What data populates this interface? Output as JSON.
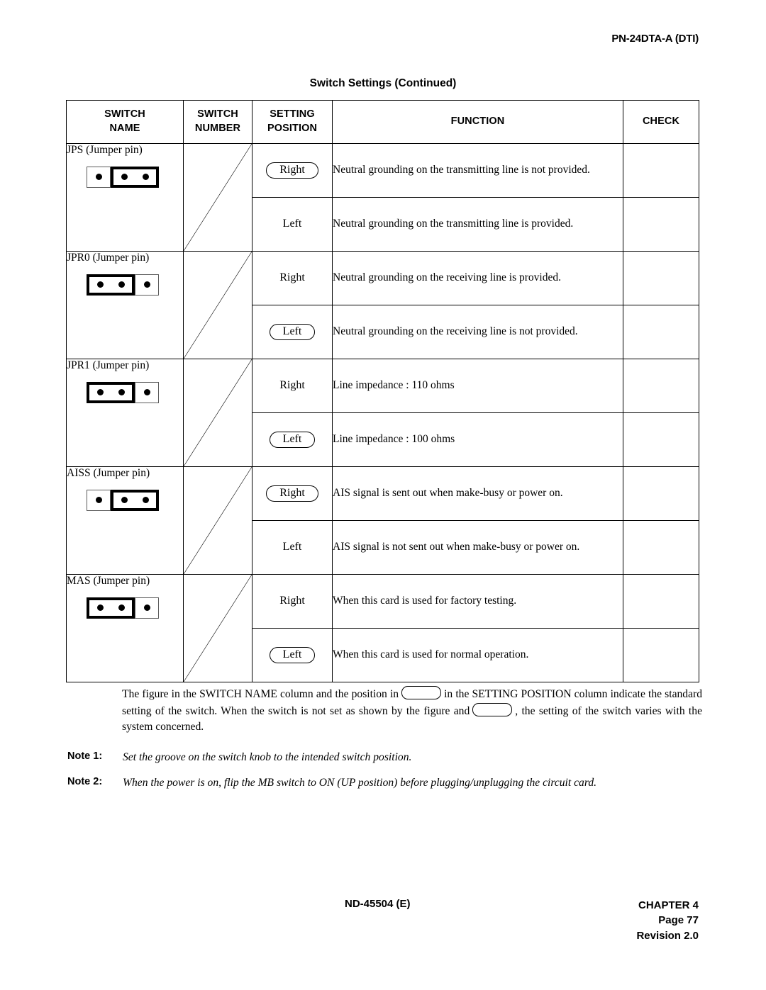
{
  "page": {
    "header_code": "PN-24DTA-A (DTI)",
    "table_title": "Switch Settings (Continued)"
  },
  "table": {
    "headers": {
      "switch_name": "SWITCH\nNAME",
      "switch_name_line1": "SWITCH",
      "switch_name_line2": "NAME",
      "switch_number_line1": "SWITCH",
      "switch_number_line2": "NUMBER",
      "setting_position_line1": "SETTING",
      "setting_position_line2": "POSITION",
      "function": "FUNCTION",
      "check": "CHECK"
    },
    "rows": [
      {
        "name": "JPS (Jumper pin)",
        "jumper_side": "right",
        "settings": [
          {
            "position": "Right",
            "standard": true,
            "function": "Neutral grounding on the transmitting line is not provided."
          },
          {
            "position": "Left",
            "standard": false,
            "function": "Neutral grounding on the transmitting line is provided."
          }
        ]
      },
      {
        "name": "JPR0 (Jumper pin)",
        "jumper_side": "left",
        "settings": [
          {
            "position": "Right",
            "standard": false,
            "function": "Neutral grounding on the receiving line is provided."
          },
          {
            "position": "Left",
            "standard": true,
            "function": "Neutral grounding on the receiving line is not provided."
          }
        ]
      },
      {
        "name": "JPR1 (Jumper pin)",
        "jumper_side": "left",
        "settings": [
          {
            "position": "Right",
            "standard": false,
            "function": "Line impedance : 110 ohms"
          },
          {
            "position": "Left",
            "standard": true,
            "function": "Line impedance : 100 ohms"
          }
        ]
      },
      {
        "name": "AISS (Jumper pin)",
        "jumper_side": "right",
        "settings": [
          {
            "position": "Right",
            "standard": true,
            "function": "AIS signal is sent out when make-busy or power on."
          },
          {
            "position": "Left",
            "standard": false,
            "function": "AIS signal is not sent out when make-busy or power on."
          }
        ]
      },
      {
        "name": "MAS (Jumper pin)",
        "jumper_side": "left",
        "settings": [
          {
            "position": "Right",
            "standard": false,
            "function": "When this card is used for factory testing."
          },
          {
            "position": "Left",
            "standard": true,
            "function": "When this card is used for normal operation."
          }
        ]
      }
    ]
  },
  "explanation": {
    "part1": "The figure in the SWITCH NAME column and the position in",
    "part2": "in the SETTING POSITION column indicate the standard setting of the switch. When the switch is not set as shown by the figure and",
    "part3": ", the setting of the switch varies with the system concerned."
  },
  "notes": [
    {
      "label": "Note 1:",
      "text": "Set the groove on the switch knob to the intended switch position."
    },
    {
      "label": "Note 2:",
      "text": "When the power is on, flip the MB switch to ON (UP position) before plugging/unplugging the circuit card."
    }
  ],
  "footer": {
    "document_number": "ND-45504 (E)",
    "chapter": "CHAPTER 4",
    "page": "Page 77",
    "revision": "Revision 2.0"
  }
}
